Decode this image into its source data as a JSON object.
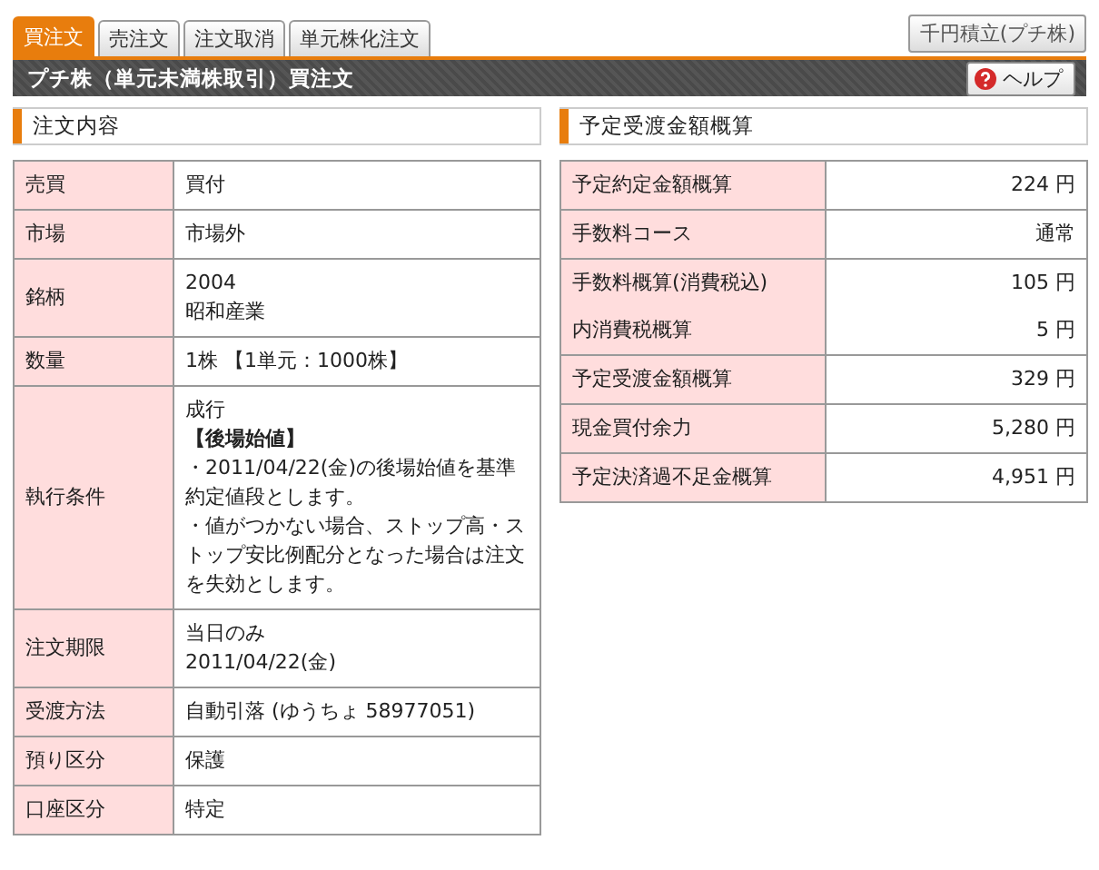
{
  "tabs": [
    {
      "label": "買注文",
      "selected": true
    },
    {
      "label": "売注文",
      "selected": false
    },
    {
      "label": "注文取消",
      "selected": false
    },
    {
      "label": "単元株化注文",
      "selected": false
    }
  ],
  "side_button": "千円積立(プチ株)",
  "header": {
    "title": "プチ株（単元未満株取引）買注文",
    "help_button": "ヘルプ"
  },
  "order": {
    "title": "注文内容",
    "rows": [
      {
        "label": "売買",
        "lines": [
          {
            "text": "買付",
            "bold": false
          }
        ]
      },
      {
        "label": "市場",
        "lines": [
          {
            "text": "市場外",
            "bold": false
          }
        ]
      },
      {
        "label": "銘柄",
        "lines": [
          {
            "text": "2004",
            "bold": false
          },
          {
            "text": "昭和産業",
            "bold": false
          }
        ]
      },
      {
        "label": "数量",
        "lines": [
          {
            "text": "1株 【1単元：1000株】",
            "bold": false
          }
        ]
      },
      {
        "label": "執行条件",
        "lines": [
          {
            "text": "成行",
            "bold": false
          },
          {
            "text": "【後場始値】",
            "bold": true
          },
          {
            "text": "・2011/04/22(金)の後場始値を基準約定値段とします。",
            "bold": false
          },
          {
            "text": "・値がつかない場合、ストップ高・ストップ安比例配分となった場合は注文を失効とします。",
            "bold": false
          }
        ]
      },
      {
        "label": "注文期限",
        "lines": [
          {
            "text": "当日のみ",
            "bold": false
          },
          {
            "text": "2011/04/22(金)",
            "bold": false
          }
        ]
      },
      {
        "label": "受渡方法",
        "lines": [
          {
            "text": "自動引落 (ゆうちょ 58977051)",
            "bold": false
          }
        ]
      },
      {
        "label": "預り区分",
        "lines": [
          {
            "text": "保護",
            "bold": false
          }
        ]
      },
      {
        "label": "口座区分",
        "lines": [
          {
            "text": "特定",
            "bold": false
          }
        ]
      }
    ]
  },
  "estimate": {
    "title": "予定受渡金額概算",
    "rows": [
      {
        "label": "予定約定金額概算",
        "value": "224 円",
        "joined": false
      },
      {
        "label": "手数料コース",
        "value": "通常",
        "joined": false
      },
      {
        "label": "手数料概算(消費税込)",
        "value": "105 円",
        "joined": false
      },
      {
        "label": "内消費税概算",
        "value": "5 円",
        "joined": true
      },
      {
        "label": "予定受渡金額概算",
        "value": "329 円",
        "joined": false
      },
      {
        "label": "現金買付余力",
        "value": "5,280 円",
        "joined": false
      },
      {
        "label": "予定決済過不足金概算",
        "value": "4,951 円",
        "joined": false
      }
    ]
  }
}
